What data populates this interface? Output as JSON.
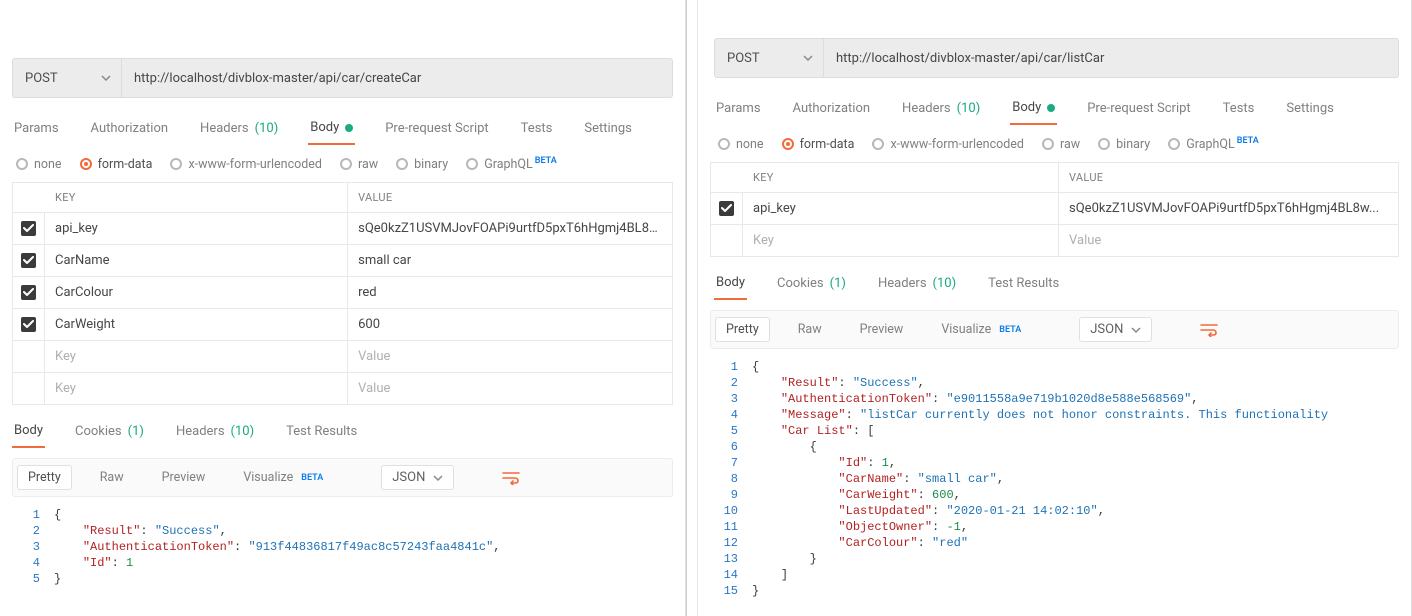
{
  "left": {
    "method": "POST",
    "url": "http://localhost/divblox-master/api/car/createCar",
    "tabs": {
      "params": "Params",
      "authorization": "Authorization",
      "headers": "Headers",
      "headers_count": "(10)",
      "body": "Body",
      "prerequest": "Pre-request Script",
      "tests": "Tests",
      "settings": "Settings"
    },
    "body_types": {
      "none": "none",
      "form_data": "form-data",
      "xwww": "x-www-form-urlencoded",
      "raw": "raw",
      "binary": "binary",
      "graphql": "GraphQL",
      "beta": "BETA"
    },
    "kv": {
      "key_header": "KEY",
      "value_header": "VALUE",
      "key_placeholder": "Key",
      "value_placeholder": "Value",
      "rows": [
        {
          "key": "api_key",
          "value": "sQe0kzZ1USVMJovFOAPi9urtfD5pxT6hHgmj4BL8w..."
        },
        {
          "key": "CarName",
          "value": "small car"
        },
        {
          "key": "CarColour",
          "value": "red"
        },
        {
          "key": "CarWeight",
          "value": "600"
        }
      ]
    },
    "resp_tabs": {
      "body": "Body",
      "cookies": "Cookies",
      "cookies_count": "(1)",
      "headers": "Headers",
      "headers_count": "(10)",
      "test_results": "Test Results"
    },
    "pretty_bar": {
      "pretty": "Pretty",
      "raw": "Raw",
      "preview": "Preview",
      "visualize": "Visualize",
      "beta": "BETA",
      "format": "JSON"
    },
    "code_lines": [
      {
        "n": "1",
        "html": "<span class='tok-punc'>{</span>"
      },
      {
        "n": "2",
        "html": "    <span class='tok-key'>\"Result\"</span><span class='tok-punc'>: </span><span class='tok-str'>\"Success\"</span><span class='tok-punc'>,</span>"
      },
      {
        "n": "3",
        "html": "    <span class='tok-key'>\"AuthenticationToken\"</span><span class='tok-punc'>: </span><span class='tok-str'>\"913f44836817f49ac8c57243faa4841c\"</span><span class='tok-punc'>,</span>"
      },
      {
        "n": "4",
        "html": "    <span class='tok-key'>\"Id\"</span><span class='tok-punc'>: </span><span class='tok-num'>1</span>"
      },
      {
        "n": "5",
        "html": "<span class='tok-punc'>}</span>"
      }
    ]
  },
  "right": {
    "method": "POST",
    "url": "http://localhost/divblox-master/api/car/listCar",
    "tabs": {
      "params": "Params",
      "authorization": "Authorization",
      "headers": "Headers",
      "headers_count": "(10)",
      "body": "Body",
      "prerequest": "Pre-request Script",
      "tests": "Tests",
      "settings": "Settings"
    },
    "body_types": {
      "none": "none",
      "form_data": "form-data",
      "xwww": "x-www-form-urlencoded",
      "raw": "raw",
      "binary": "binary",
      "graphql": "GraphQL",
      "beta": "BETA"
    },
    "kv": {
      "key_header": "KEY",
      "value_header": "VALUE",
      "key_placeholder": "Key",
      "value_placeholder": "Value",
      "rows": [
        {
          "key": "api_key",
          "value": "sQe0kzZ1USVMJovFOAPi9urtfD5pxT6hHgmj4BL8w..."
        }
      ]
    },
    "resp_tabs": {
      "body": "Body",
      "cookies": "Cookies",
      "cookies_count": "(1)",
      "headers": "Headers",
      "headers_count": "(10)",
      "test_results": "Test Results"
    },
    "pretty_bar": {
      "pretty": "Pretty",
      "raw": "Raw",
      "preview": "Preview",
      "visualize": "Visualize",
      "beta": "BETA",
      "format": "JSON"
    },
    "code_lines": [
      {
        "n": "1",
        "html": "<span class='tok-punc'>{</span>"
      },
      {
        "n": "2",
        "html": "    <span class='tok-key'>\"Result\"</span><span class='tok-punc'>: </span><span class='tok-str'>\"Success\"</span><span class='tok-punc'>,</span>"
      },
      {
        "n": "3",
        "html": "    <span class='tok-key'>\"AuthenticationToken\"</span><span class='tok-punc'>: </span><span class='tok-str'>\"e9011558a9e719b1020d8e588e568569\"</span><span class='tok-punc'>,</span>"
      },
      {
        "n": "4",
        "html": "    <span class='tok-key'>\"Message\"</span><span class='tok-punc'>: </span><span class='tok-str'>\"listCar currently does not honor constraints. This functionality</span>"
      },
      {
        "n": "5",
        "html": "    <span class='tok-key'>\"Car List\"</span><span class='tok-punc'>: [</span>"
      },
      {
        "n": "6",
        "html": "        <span class='tok-punc'>{</span>"
      },
      {
        "n": "7",
        "html": "            <span class='tok-key'>\"Id\"</span><span class='tok-punc'>: </span><span class='tok-num'>1</span><span class='tok-punc'>,</span>"
      },
      {
        "n": "8",
        "html": "            <span class='tok-key'>\"CarName\"</span><span class='tok-punc'>: </span><span class='tok-str'>\"small car\"</span><span class='tok-punc'>,</span>"
      },
      {
        "n": "9",
        "html": "            <span class='tok-key'>\"CarWeight\"</span><span class='tok-punc'>: </span><span class='tok-num'>600</span><span class='tok-punc'>,</span>"
      },
      {
        "n": "10",
        "html": "            <span class='tok-key'>\"LastUpdated\"</span><span class='tok-punc'>: </span><span class='tok-str'>\"2020-01-21 14:02:10\"</span><span class='tok-punc'>,</span>"
      },
      {
        "n": "11",
        "html": "            <span class='tok-key'>\"ObjectOwner\"</span><span class='tok-punc'>: </span><span class='tok-num'>-1</span><span class='tok-punc'>,</span>"
      },
      {
        "n": "12",
        "html": "            <span class='tok-key'>\"CarColour\"</span><span class='tok-punc'>: </span><span class='tok-str'>\"red\"</span>"
      },
      {
        "n": "13",
        "html": "        <span class='tok-punc'>}</span>"
      },
      {
        "n": "14",
        "html": "    <span class='tok-punc'>]</span>"
      },
      {
        "n": "15",
        "html": "<span class='tok-punc'>}</span>"
      }
    ]
  }
}
